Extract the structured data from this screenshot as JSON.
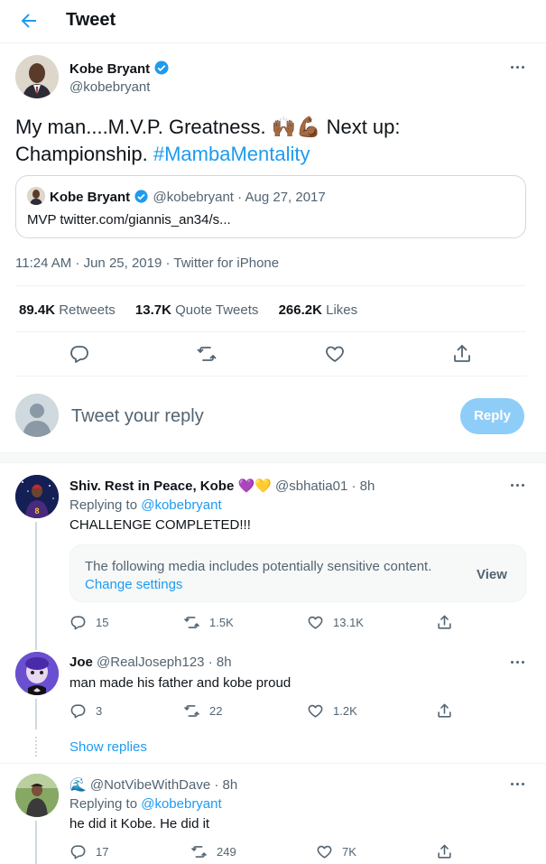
{
  "header": {
    "title": "Tweet"
  },
  "tweet": {
    "author_name": "Kobe Bryant",
    "author_handle": "@kobebryant",
    "text_1": "My man....M.V.P. Greatness. ",
    "emoji_1": "🙌🏾💪🏾",
    "text_2": " Next up:",
    "text_3": "Championship. ",
    "hashtag": "#MambaMentality",
    "quote": {
      "author_name": "Kobe Bryant",
      "author_handle": "@kobebryant",
      "sep": "·",
      "date": "Aug 27, 2017",
      "text": "MVP twitter.com/giannis_an34/s..."
    },
    "timestamp": "11:24 AM · Jun 25, 2019 · Twitter for iPhone",
    "stats": {
      "retweets_count": "89.4K",
      "retweets_label": "Retweets",
      "quotes_count": "13.7K",
      "quotes_label": "Quote Tweets",
      "likes_count": "266.2K",
      "likes_label": "Likes"
    }
  },
  "compose": {
    "placeholder": "Tweet your reply",
    "button": "Reply"
  },
  "replies": [
    {
      "name": "Shiv. Rest in Peace, Kobe",
      "name_emoji": "💜💛",
      "handle": "@sbhatia01",
      "sep": "·",
      "time": "8h",
      "replying_label": "Replying to",
      "replying_handle": "@kobebryant",
      "text": "CHALLENGE COMPLETED!!!",
      "sensitive_text": "The following media includes potentially sensitive content.",
      "sensitive_link": "Change settings",
      "sensitive_button": "View",
      "comments": "15",
      "retweets": "1.5K",
      "likes": "13.1K"
    },
    {
      "name": "Joe",
      "handle": "@RealJoseph123",
      "sep": "·",
      "time": "8h",
      "text": "man made his father and kobe proud",
      "comments": "3",
      "retweets": "22",
      "likes": "1.2K"
    },
    {
      "show_replies": "Show replies"
    },
    {
      "name_emoji": "🌊",
      "handle": "@NotVibeWithDave",
      "sep": "·",
      "time": "8h",
      "replying_label": "Replying to",
      "replying_handle": "@kobebryant",
      "text": "he did it Kobe. He did it",
      "comments": "17",
      "retweets": "249",
      "likes": "7K"
    }
  ],
  "colors": {
    "accent": "#1d9bf0",
    "muted": "#536471",
    "border": "#cfd9de",
    "reply_button_disabled": "#8ecdf8"
  },
  "icons": [
    "back-arrow-icon",
    "verified-badge-icon",
    "more-icon",
    "reply-icon",
    "retweet-icon",
    "like-icon",
    "share-icon",
    "default-avatar-icon"
  ]
}
